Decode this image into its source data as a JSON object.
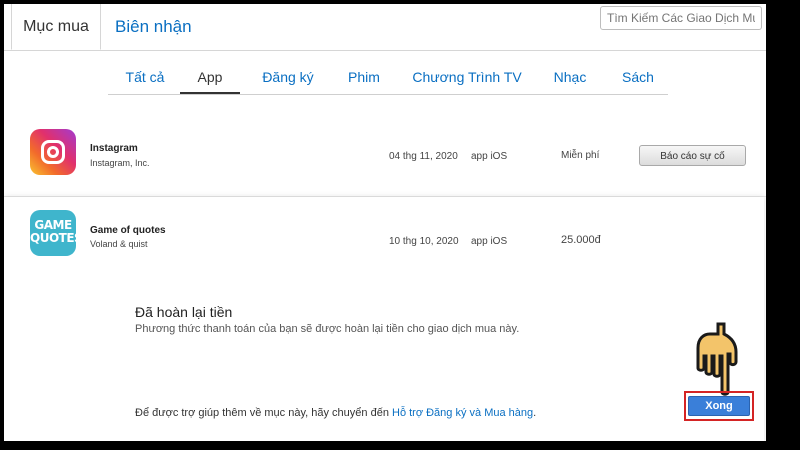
{
  "tabs": {
    "purchases": "Mục mua",
    "receipts": "Biên nhận"
  },
  "search": {
    "placeholder": "Tìm Kiếm Các Giao Dịch Mua H"
  },
  "categories": [
    "Tất cả",
    "App",
    "Đăng ký",
    "Phim",
    "Chương Trình TV",
    "Nhạc",
    "Sách"
  ],
  "active_category": "App",
  "purchases": [
    {
      "name": "Instagram",
      "developer": "Instagram, Inc.",
      "date": "04 thg 11, 2020",
      "type": "app iOS",
      "price": "Miễn phí",
      "action": "Báo cáo sự cố",
      "icon": "instagram-icon"
    },
    {
      "name": "Game of quotes",
      "developer": "Voland & quist",
      "date": "10 thg 10, 2020",
      "type": "app iOS",
      "price": "25.000đ",
      "icon": "game-of-quotes-icon",
      "icon_text": "GAME QUOTES"
    }
  ],
  "refund": {
    "title": "Đã hoàn lại tiền",
    "description": "Phương thức thanh toán của bạn sẽ được hoàn lại tiền cho giao dịch mua này.",
    "help_prefix": "Để được trợ giúp thêm về mục này, hãy chuyển đến",
    "help_link": "Hỗ trợ Đăng ký và Mua hàng",
    "help_suffix": ".",
    "done_button": "Xong"
  },
  "colors": {
    "link": "#0a6fc2",
    "done_button": "#3a7fd9",
    "highlight": "#d42424"
  }
}
